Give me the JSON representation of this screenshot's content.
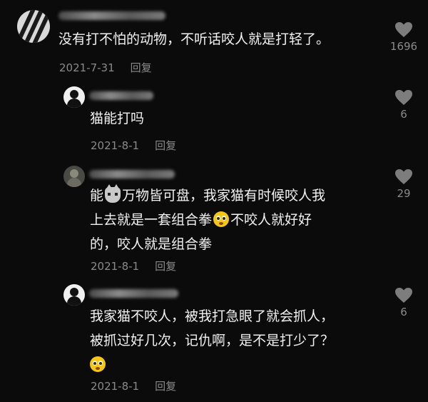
{
  "comments": [
    {
      "text_lines": [
        "没有打不怕的动物，不听话咬人就是打轻了。"
      ],
      "date": "2021-7-31",
      "reply_label": "回复",
      "likes": "1696"
    },
    {
      "text_lines": [
        "猫能打吗"
      ],
      "date": "2021-8-1",
      "reply_label": "回复",
      "likes": "6"
    },
    {
      "text_parts": {
        "l1a": "能",
        "l1b": "万物皆可盘，我家猫有时候咬人我",
        "l2a": "上去就是一套组合拳",
        "l2b": "不咬人就好好",
        "l3": "的，咬人就是组合拳"
      },
      "emoji": [
        "cat-face-emoji",
        "pleading-face-emoji"
      ],
      "date": "2021-8-1",
      "reply_label": "回复",
      "likes": "29"
    },
    {
      "text_lines": [
        "我家猫不咬人，被我打急眼了就会抓人，",
        "被抓过好几次，记仇啊，是不是打少了？"
      ],
      "emoji": [
        "flushed-face-emoji"
      ],
      "date": "2021-8-1",
      "reply_label": "回复",
      "likes": "6"
    }
  ],
  "colors": {
    "background": "#0b0b0b",
    "text": "#f2f2f2",
    "meta": "#8a8a8a",
    "heart": "#7d7d7d"
  }
}
